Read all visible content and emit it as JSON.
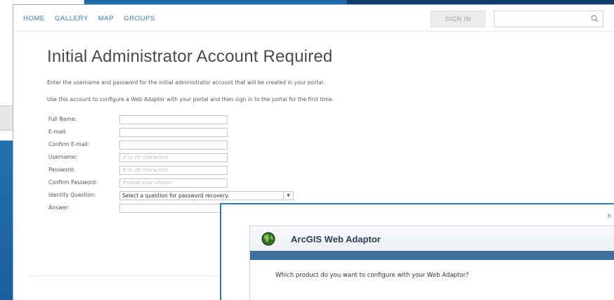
{
  "nav": {
    "links": [
      "HOME",
      "GALLERY",
      "MAP",
      "GROUPS"
    ],
    "signin_label": "SIGN IN",
    "search_icon": "search-icon"
  },
  "page": {
    "title": "Initial Administrator Account Required",
    "intro1": "Enter the username and password for the initial administrator account that will be created in your portal.",
    "intro2": "Use this account to configure a Web Adaptor with your portal and then sign in to the portal for the first time."
  },
  "form": {
    "full_name_label": "Full Name:",
    "email_label": "E-mail:",
    "confirm_email_label": "Confirm E-mail:",
    "username_label": "Username:",
    "username_placeholder": "4 to 24 characters",
    "password_label": "Password:",
    "password_placeholder": "8 to 28 characters",
    "confirm_password_label": "Confirm Password:",
    "confirm_password_placeholder": "Repeat your chosen",
    "identity_question_label": "Identity Question:",
    "identity_question_value": "Select a question for password recovery.",
    "answer_label": "Answer:"
  },
  "web_adaptor": {
    "title": "ArcGIS Web Adaptor",
    "question": "Which product do you want to configure with your Web Adaptor?",
    "corner_glyph": "h"
  },
  "colors": {
    "accent": "#2f7ab8",
    "desktop": "#1c6aa8",
    "band": "#3f6f9d"
  }
}
